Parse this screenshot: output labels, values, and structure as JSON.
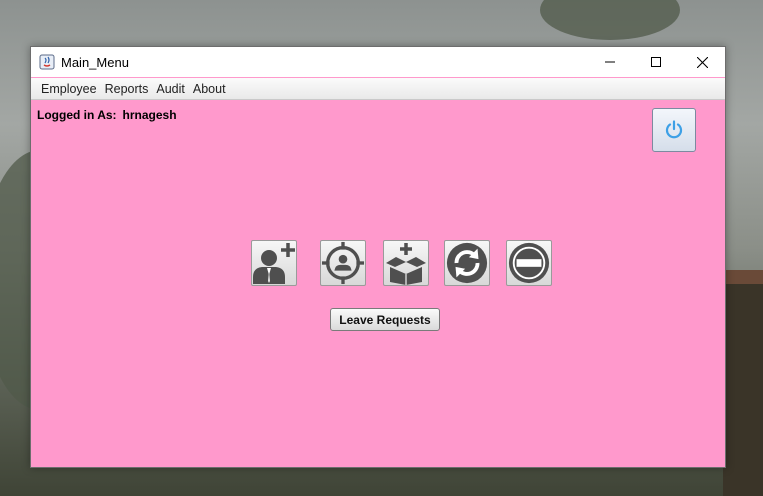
{
  "window": {
    "title": "Main_Menu"
  },
  "menu": [
    {
      "label": "Employee"
    },
    {
      "label": "Reports"
    },
    {
      "label": "Audit"
    },
    {
      "label": "About"
    }
  ],
  "session": {
    "label": "Logged in As:",
    "user": "hrnagesh"
  },
  "toolbar": {
    "buttons": [
      {
        "icon": "add-employee-icon"
      },
      {
        "icon": "target-employee-icon"
      },
      {
        "icon": "add-package-icon"
      },
      {
        "icon": "refresh-icon"
      },
      {
        "icon": "remove-icon"
      }
    ]
  },
  "actions": {
    "leave_requests": "Leave Requests"
  },
  "colors": {
    "panel": "#ff99cc",
    "power_icon": "#3da0e6",
    "icon_gray": "#4f4f4f"
  }
}
